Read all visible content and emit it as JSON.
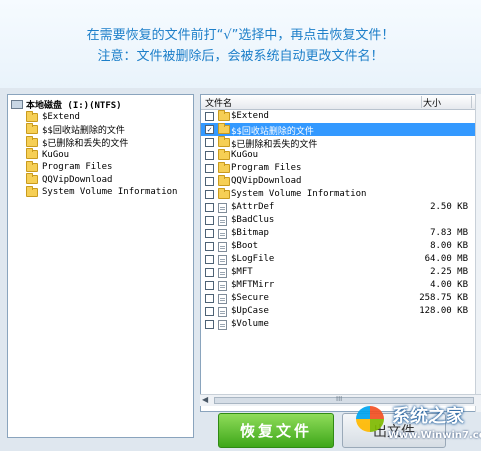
{
  "banner": {
    "line1": "在需要恢复的文件前打“√”选择中，再点击恢复文件！",
    "line2": "注意：文件被删除后，会被系统自动更改文件名！"
  },
  "tree": {
    "root": "本地磁盘 (I:)(NTFS)",
    "items": [
      "$Extend",
      "$$回收站删除的文件",
      "$已删除和丢失的文件",
      "KuGou",
      "Program Files",
      "QQVipDownload",
      "System Volume Information"
    ]
  },
  "list": {
    "columns": {
      "name": "文件名",
      "size": "大小"
    },
    "rows": [
      {
        "name": "$Extend",
        "size": "",
        "type": "folder",
        "checked": false,
        "trail": "0"
      },
      {
        "name": "$$回收站删除的文件",
        "size": "",
        "type": "folder",
        "checked": true,
        "check_mark": "✓",
        "trail": "0"
      },
      {
        "name": "$已删除和丢失的文件",
        "size": "",
        "type": "folder",
        "checked": false,
        "trail": "0"
      },
      {
        "name": "KuGou",
        "size": "",
        "type": "folder",
        "checked": false,
        "trail": "1"
      },
      {
        "name": "Program Files",
        "size": "",
        "type": "folder",
        "checked": false,
        "trail": "1"
      },
      {
        "name": "QQVipDownload",
        "size": "",
        "type": "folder",
        "checked": false,
        "trail": "1"
      },
      {
        "name": "System Volume Information",
        "size": "",
        "type": "folder",
        "checked": false,
        "trail": "0"
      },
      {
        "name": "$AttrDef",
        "size": "2.50 KB",
        "type": "file",
        "checked": false,
        "trail": "0"
      },
      {
        "name": "$BadClus",
        "size": "",
        "type": "file",
        "checked": false,
        "trail": "0"
      },
      {
        "name": "$Bitmap",
        "size": "7.83 MB",
        "type": "file",
        "checked": false,
        "trail": "0"
      },
      {
        "name": "$Boot",
        "size": "8.00 KB",
        "type": "file",
        "checked": false,
        "trail": "0"
      },
      {
        "name": "$LogFile",
        "size": "64.00 MB",
        "type": "file",
        "checked": false,
        "trail": "0"
      },
      {
        "name": "$MFT",
        "size": "2.25 MB",
        "type": "file",
        "checked": false,
        "trail": "0"
      },
      {
        "name": "$MFTMirr",
        "size": "4.00 KB",
        "type": "file",
        "checked": false,
        "trail": "0"
      },
      {
        "name": "$Secure",
        "size": "258.75 KB",
        "type": "file",
        "checked": false,
        "trail": "0"
      },
      {
        "name": "$UpCase",
        "size": "128.00 KB",
        "type": "file",
        "checked": false,
        "trail": "0"
      },
      {
        "name": "$Volume",
        "size": "",
        "type": "file",
        "checked": false,
        "trail": "0"
      }
    ]
  },
  "scrollbar": {
    "left_arrow": "◀",
    "grip": "III"
  },
  "buttons": {
    "recover": "恢复文件",
    "second": "出文件"
  },
  "watermark": {
    "title": "系统之家",
    "url": "Www.Winwin7.com"
  },
  "colors": {
    "accent": "#1d7fc9",
    "selection": "#3399ff",
    "recover_button": "#3ea719"
  }
}
